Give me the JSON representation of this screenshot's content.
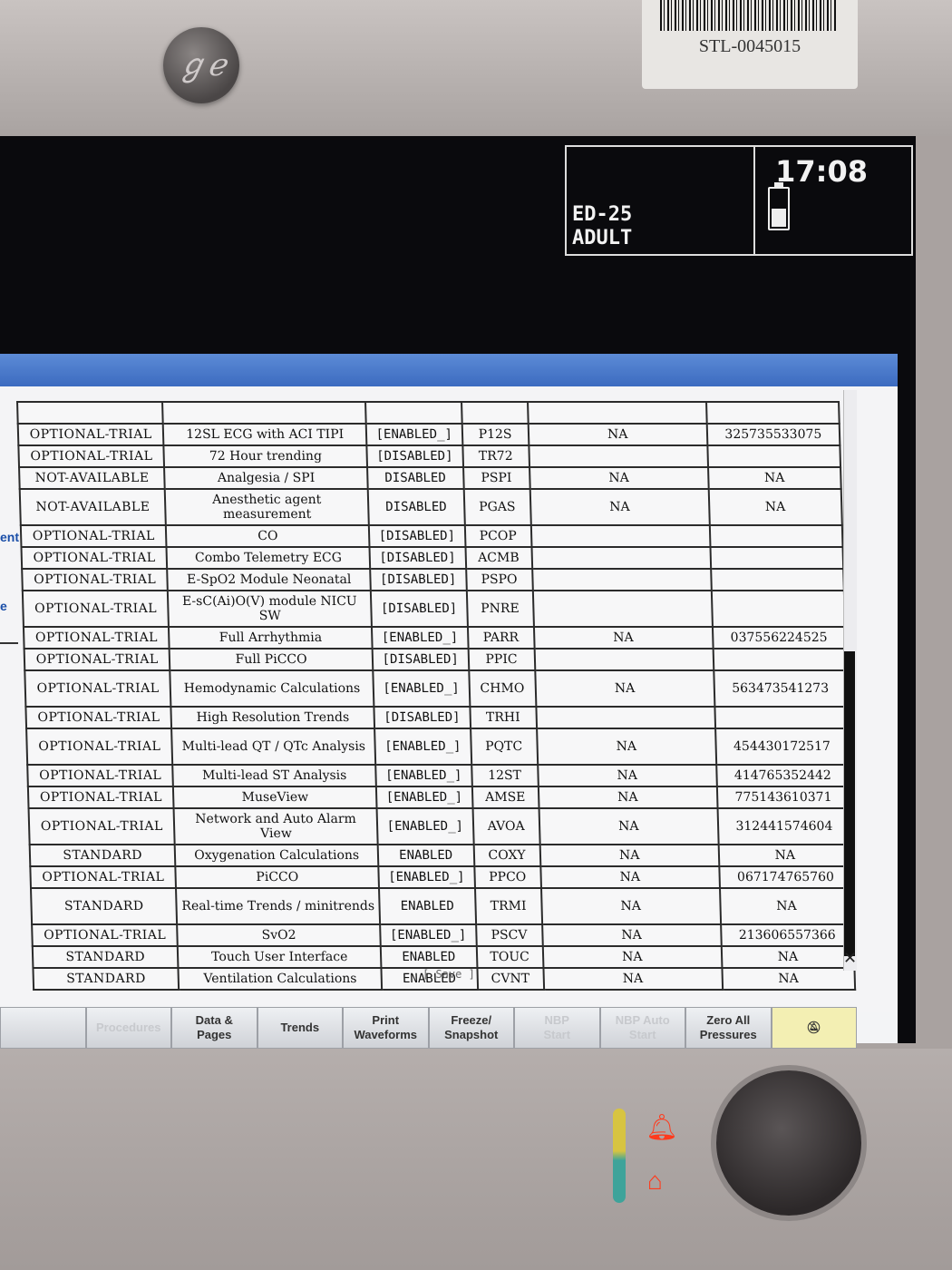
{
  "device": {
    "logo": "GE",
    "asset_tag": "STL-0045015"
  },
  "header": {
    "unit": "ED-25",
    "patient_type": "ADULT",
    "time": "17:08",
    "battery_level": 0.45
  },
  "side_fragments": [
    "ent",
    "e"
  ],
  "features": {
    "rows": [
      {
        "status": "OPTIONAL-TRIAL",
        "feature": "12SL ECG with ACI TIPI",
        "state": "[ENABLED_]",
        "code": "P12S",
        "col5": "NA",
        "col6": "325735533075"
      },
      {
        "status": "OPTIONAL-TRIAL",
        "feature": "72 Hour trending",
        "state": "[DISABLED]",
        "code": "TR72",
        "col5": "",
        "col6": ""
      },
      {
        "status": "NOT-AVAILABLE",
        "feature": "Analgesia / SPI",
        "state": "DISABLED",
        "code": "PSPI",
        "col5": "NA",
        "col6": "NA"
      },
      {
        "status": "NOT-AVAILABLE",
        "feature": "Anesthetic agent measurement",
        "state": "DISABLED",
        "code": "PGAS",
        "col5": "NA",
        "col6": "NA",
        "tall": true
      },
      {
        "status": "OPTIONAL-TRIAL",
        "feature": "CO",
        "state": "[DISABLED]",
        "code": "PCOP",
        "col5": "",
        "col6": ""
      },
      {
        "status": "OPTIONAL-TRIAL",
        "feature": "Combo Telemetry ECG",
        "state": "[DISABLED]",
        "code": "ACMB",
        "col5": "",
        "col6": ""
      },
      {
        "status": "OPTIONAL-TRIAL",
        "feature": "E-SpO2 Module Neonatal",
        "state": "[DISABLED]",
        "code": "PSPO",
        "col5": "",
        "col6": ""
      },
      {
        "status": "OPTIONAL-TRIAL",
        "feature": "E-sC(Ai)O(V) module NICU SW",
        "state": "[DISABLED]",
        "code": "PNRE",
        "col5": "",
        "col6": "",
        "tall": true
      },
      {
        "status": "OPTIONAL-TRIAL",
        "feature": "Full Arrhythmia",
        "state": "[ENABLED_]",
        "code": "PARR",
        "col5": "NA",
        "col6": "037556224525"
      },
      {
        "status": "OPTIONAL-TRIAL",
        "feature": "Full PiCCO",
        "state": "[DISABLED]",
        "code": "PPIC",
        "col5": "",
        "col6": ""
      },
      {
        "status": "OPTIONAL-TRIAL",
        "feature": "Hemodynamic Calculations",
        "state": "[ENABLED_]",
        "code": "CHMO",
        "col5": "NA",
        "col6": "563473541273",
        "tall": true
      },
      {
        "status": "OPTIONAL-TRIAL",
        "feature": "High Resolution Trends",
        "state": "[DISABLED]",
        "code": "TRHI",
        "col5": "",
        "col6": ""
      },
      {
        "status": "OPTIONAL-TRIAL",
        "feature": "Multi-lead QT / QTc Analysis",
        "state": "[ENABLED_]",
        "code": "PQTC",
        "col5": "NA",
        "col6": "454430172517",
        "tall": true
      },
      {
        "status": "OPTIONAL-TRIAL",
        "feature": "Multi-lead ST Analysis",
        "state": "[ENABLED_]",
        "code": "12ST",
        "col5": "NA",
        "col6": "414765352442"
      },
      {
        "status": "OPTIONAL-TRIAL",
        "feature": "MuseView",
        "state": "[ENABLED_]",
        "code": "AMSE",
        "col5": "NA",
        "col6": "775143610371"
      },
      {
        "status": "OPTIONAL-TRIAL",
        "feature": "Network and Auto Alarm View",
        "state": "[ENABLED_]",
        "code": "AVOA",
        "col5": "NA",
        "col6": "312441574604",
        "tall": true
      },
      {
        "status": "STANDARD",
        "feature": "Oxygenation Calculations",
        "state": "ENABLED",
        "code": "COXY",
        "col5": "NA",
        "col6": "NA"
      },
      {
        "status": "OPTIONAL-TRIAL",
        "feature": "PiCCO",
        "state": "[ENABLED_]",
        "code": "PPCO",
        "col5": "NA",
        "col6": "067174765760"
      },
      {
        "status": "STANDARD",
        "feature": "Real-time Trends / minitrends",
        "state": "ENABLED",
        "code": "TRMI",
        "col5": "NA",
        "col6": "NA",
        "tall": true
      },
      {
        "status": "OPTIONAL-TRIAL",
        "feature": "SvO2",
        "state": "[ENABLED_]",
        "code": "PSCV",
        "col5": "NA",
        "col6": "213606557366"
      },
      {
        "status": "STANDARD",
        "feature": "Touch User Interface",
        "state": "ENABLED",
        "code": "TOUC",
        "col5": "NA",
        "col6": "NA"
      },
      {
        "status": "STANDARD",
        "feature": "Ventilation Calculations",
        "state": "ENABLED",
        "code": "CVNT",
        "col5": "NA",
        "col6": "NA"
      }
    ]
  },
  "save_label": "[ Save ]",
  "bottom_bar": [
    {
      "label": "",
      "name": "bottom-btn-partial",
      "dim": false
    },
    {
      "label": "Procedures",
      "name": "procedures-button",
      "dim": true
    },
    {
      "label": "Data &\nPages",
      "name": "data-pages-button",
      "dim": false
    },
    {
      "label": "Trends",
      "name": "trends-button",
      "dim": false
    },
    {
      "label": "Print\nWaveforms",
      "name": "print-waveforms-button",
      "dim": false
    },
    {
      "label": "Freeze/\nSnapshot",
      "name": "freeze-snapshot-button",
      "dim": false
    },
    {
      "label": "NBP\nStart",
      "name": "nbp-start-button",
      "dim": true
    },
    {
      "label": "NBP Auto\nStart",
      "name": "nbp-auto-start-button",
      "dim": true
    },
    {
      "label": "Zero All\nPressures",
      "name": "zero-all-pressures-button",
      "dim": false
    },
    {
      "label": "",
      "name": "alarm-silence-button",
      "dim": false,
      "alarm": true
    }
  ],
  "colors": {
    "screen_bg": "#0a0a0d",
    "panel_bar": "#3c6bc0",
    "alarm_button": "#f3efb3",
    "led": "#ff3a1c"
  }
}
